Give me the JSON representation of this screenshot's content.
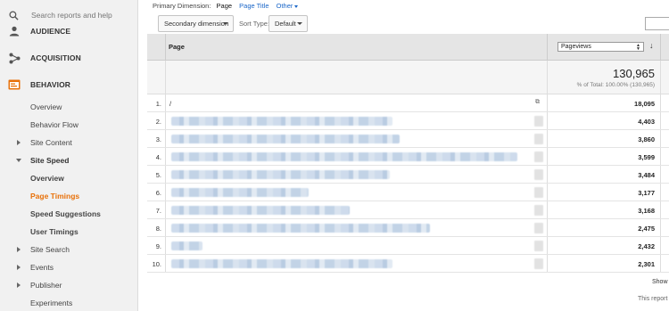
{
  "sidebar": {
    "search_placeholder": "Search reports and help",
    "sections": {
      "audience": "AUDIENCE",
      "acquisition": "ACQUISITION",
      "behavior": "BEHAVIOR"
    },
    "behavior_items": {
      "overview": "Overview",
      "behavior_flow": "Behavior Flow",
      "site_content": "Site Content",
      "site_speed": "Site Speed",
      "site_speed_overview": "Overview",
      "page_timings": "Page Timings",
      "speed_suggestions": "Speed Suggestions",
      "user_timings": "User Timings",
      "site_search": "Site Search",
      "events": "Events",
      "publisher": "Publisher",
      "experiments": "Experiments"
    },
    "active_item": "Page Timings",
    "accent_color": "#e8710a"
  },
  "toolbar": {
    "primary_dimension_label": "Primary Dimension:",
    "primary_dimension_selected": "Page",
    "primary_dimension_alt": "Page Title",
    "primary_dimension_other": "Other",
    "secondary_dimension": "Secondary dimension",
    "sort_type_label": "Sort Type:",
    "sort_type_value": "Default"
  },
  "table": {
    "column_page": "Page",
    "metric_select": "Pageviews",
    "total_value": "130,965",
    "total_pct": "% of Total: 100.00% (130,965)",
    "rows": [
      {
        "num": "1.",
        "page": "/",
        "value": "18,095"
      },
      {
        "num": "2.",
        "page": "",
        "value": "4,403"
      },
      {
        "num": "3.",
        "page": "",
        "value": "3,860"
      },
      {
        "num": "4.",
        "page": "",
        "value": "3,599"
      },
      {
        "num": "5.",
        "page": "",
        "value": "3,484"
      },
      {
        "num": "6.",
        "page": "",
        "value": "3,177"
      },
      {
        "num": "7.",
        "page": "",
        "value": "3,168"
      },
      {
        "num": "8.",
        "page": "",
        "value": "2,475"
      },
      {
        "num": "9.",
        "page": "",
        "value": "2,432"
      },
      {
        "num": "10.",
        "page": "",
        "value": "2,301"
      }
    ]
  },
  "footer": {
    "show": "Show",
    "note": "This report"
  }
}
